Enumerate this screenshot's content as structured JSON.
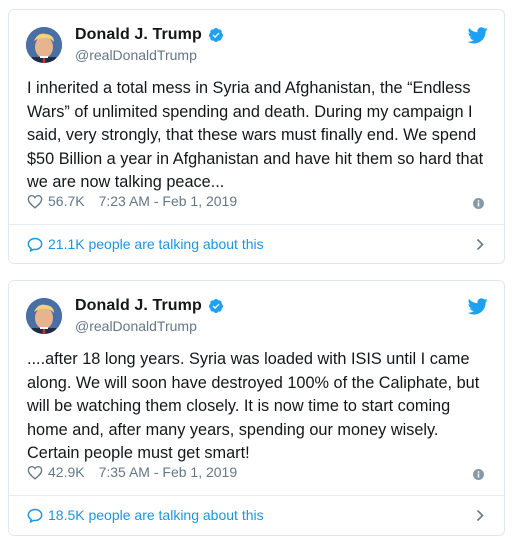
{
  "tweets": [
    {
      "display_name": "Donald J. Trump",
      "handle": "@realDonaldTrump",
      "text": "I inherited a total mess in Syria and Afghanistan, the “Endless Wars” of unlimited spending and death. During my campaign I said, very strongly, that these wars must finally end. We spend $50 Billion a year in Afghanistan and have hit them so hard that we are now talking peace...",
      "likes": "56.7K",
      "timestamp": "7:23 AM - Feb 1, 2019",
      "talking": "21.1K people are talking about this"
    },
    {
      "display_name": "Donald J. Trump",
      "handle": "@realDonaldTrump",
      "text": "....after 18 long years. Syria was loaded with ISIS until I came along. We will soon have destroyed 100% of the Caliphate, but will be watching them closely. It is now time to start coming home and, after many years, spending our money wisely. Certain people must get smart!",
      "likes": "42.9K",
      "timestamp": "7:35 AM - Feb 1, 2019",
      "talking": "18.5K people are talking about this"
    }
  ],
  "icons": {
    "verified": "verified-badge-icon",
    "brand": "twitter-bird-icon",
    "like": "heart-icon",
    "info": "info-icon",
    "reply": "speech-bubble-icon",
    "chevron": "chevron-right-icon"
  },
  "colors": {
    "brand_blue": "#1da1f2",
    "link_blue": "#1b95e0",
    "secondary_text": "#657786",
    "border": "#e1e8ed"
  }
}
